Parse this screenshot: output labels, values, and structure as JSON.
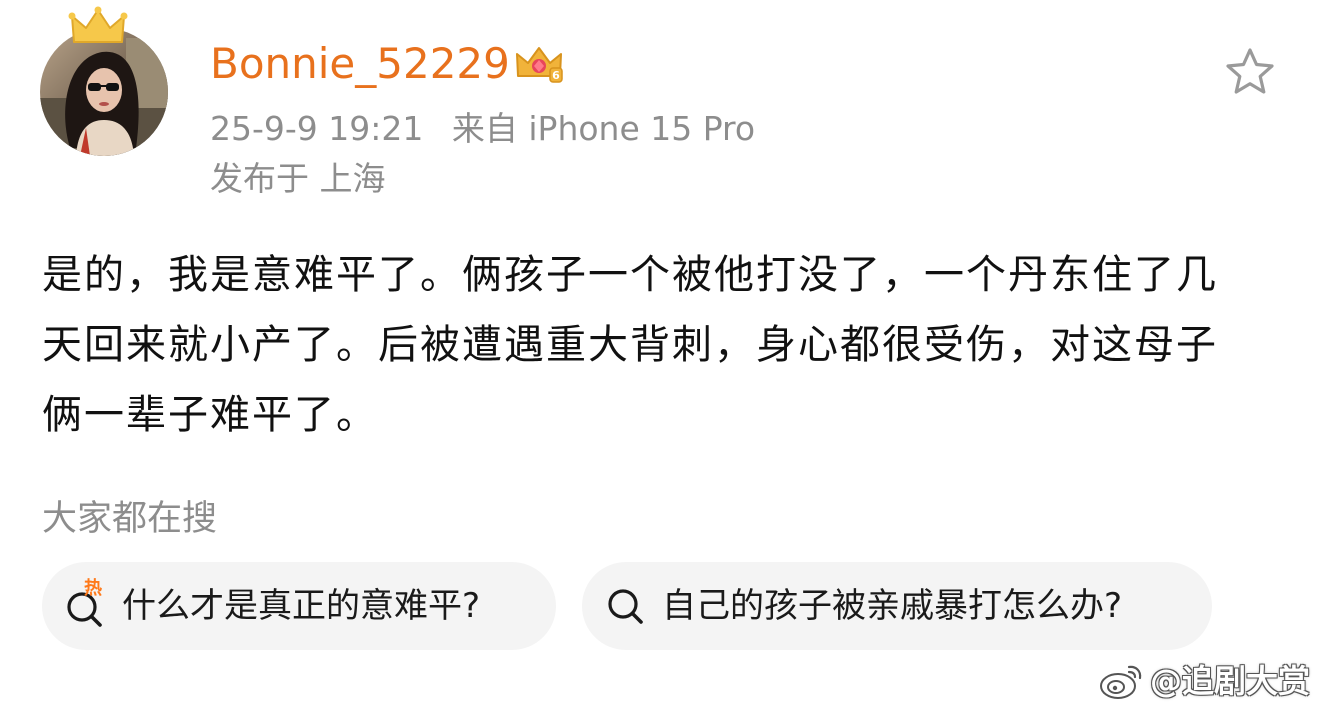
{
  "post": {
    "author": {
      "username": "Bonnie_52229",
      "avatar_icon": "woman-with-sunglasses-avatar",
      "crown_icon": "gold-crown-icon",
      "vip_badge_icon": "vip-crown-badge-icon",
      "vip_level": "6"
    },
    "meta": {
      "date_time": "25-9-9 19:21",
      "source": "来自 iPhone 15 Pro",
      "location": "发布于 上海"
    },
    "favorite_icon": "star-outline-icon",
    "text": "是的，我是意难平了。俩孩子一个被他打没了，一个丹东住了几天回来就小产了。后被遭遇重大背刺，身心都很受伤，对这母子俩一辈子难平了。"
  },
  "searches": {
    "heading": "大家都在搜",
    "items": [
      {
        "label": "什么才是真正的意难平?",
        "icon": "hot-search-icon",
        "hot_tag": "热"
      },
      {
        "label": "自己的孩子被亲戚暴打怎么办?",
        "icon": "search-icon"
      }
    ]
  },
  "watermark": {
    "logo_icon": "weibo-logo-icon",
    "text": "@追剧大赏"
  },
  "colors": {
    "username": "#e8711d",
    "meta_text": "#8d8d8d",
    "body_text": "#111111",
    "chip_bg": "#f4f4f4",
    "hot_tag": "#ff7a1a",
    "vip_gold": "#f1b33a"
  }
}
